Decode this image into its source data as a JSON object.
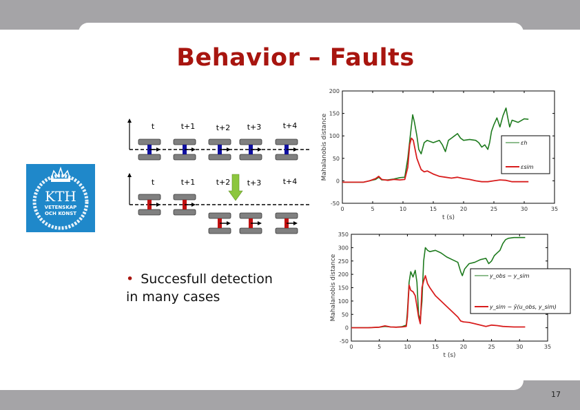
{
  "slide": {
    "title": "Behavior – Faults",
    "page_number": "17",
    "bullet": [
      "Succesfull detection",
      "in many cases"
    ],
    "colors": {
      "title": "#a8150f",
      "band": "#a5a4a7",
      "logo_bg": "#1f88ca"
    }
  },
  "logo": {
    "name": "KTH",
    "line1": "VETENSKAP",
    "line2": "OCH KONST"
  },
  "diagram": {
    "normal_row": {
      "labels": [
        "t",
        "t+1",
        "t+2",
        "t+3",
        "t+4"
      ],
      "color": "#1010a0"
    },
    "fault_row": {
      "labels": [
        "t",
        "t+1",
        "t+2",
        "t+3",
        "t+4"
      ],
      "color": "#c01010",
      "fault_at": "t+2"
    },
    "arrow_color": "#8cc63e"
  },
  "chart_data": [
    {
      "type": "line",
      "title": "",
      "xlabel": "t (s)",
      "ylabel": "Mahalanobis distance",
      "xlim": [
        0,
        35
      ],
      "ylim": [
        -50,
        200
      ],
      "xticks": [
        0,
        5,
        10,
        15,
        20,
        25,
        30,
        35
      ],
      "yticks": [
        -50,
        0,
        50,
        100,
        150,
        200
      ],
      "legend": "right",
      "series": [
        {
          "name": "εh",
          "color": "#1d7a1d",
          "x": [
            0,
            2,
            3.5,
            4.5,
            5.5,
            6,
            6.5,
            7.5,
            8.5,
            9.5,
            10.3,
            10.8,
            11.2,
            11.6,
            11.9,
            12.3,
            12.6,
            13,
            13.5,
            14,
            15,
            16,
            16.5,
            17,
            17.5,
            18,
            18.5,
            19,
            19.5,
            20,
            21,
            22,
            22.5,
            23,
            23.5,
            24,
            24.3,
            24.6,
            25,
            25.5,
            26,
            26.5,
            27,
            27.3,
            27.6,
            28,
            29,
            30,
            30.7
          ],
          "values": [
            -3,
            -3,
            -3,
            0,
            3,
            8,
            2,
            2,
            4,
            7,
            8,
            50,
            100,
            147,
            130,
            100,
            70,
            60,
            85,
            90,
            85,
            90,
            80,
            65,
            90,
            95,
            100,
            105,
            95,
            90,
            92,
            90,
            85,
            75,
            80,
            70,
            85,
            110,
            125,
            140,
            120,
            145,
            162,
            140,
            120,
            135,
            130,
            138,
            137
          ]
        },
        {
          "name": "εsim",
          "color": "#d81c1c",
          "x": [
            0,
            2,
            3.5,
            4.5,
            5.5,
            6,
            6.5,
            7.5,
            8.5,
            9.5,
            10.3,
            10.8,
            11.1,
            11.4,
            11.7,
            12,
            12.3,
            12.7,
            13,
            13.5,
            14,
            15,
            16,
            17,
            18,
            19,
            20,
            21,
            22,
            23,
            24,
            25,
            26,
            27,
            28,
            29,
            30,
            30.7
          ],
          "values": [
            -3,
            -3,
            -3,
            0,
            5,
            10,
            3,
            1,
            3,
            2,
            3,
            30,
            80,
            95,
            90,
            70,
            50,
            35,
            25,
            20,
            22,
            15,
            10,
            8,
            6,
            8,
            5,
            3,
            0,
            -2,
            -2,
            0,
            2,
            1,
            -2,
            -2,
            -2,
            -2
          ]
        }
      ]
    },
    {
      "type": "line",
      "title": "",
      "xlabel": "t (s)",
      "ylabel": "Mahalanobis distance",
      "xlim": [
        0,
        35
      ],
      "ylim": [
        -50,
        350
      ],
      "xticks": [
        0,
        5,
        10,
        15,
        20,
        25,
        30,
        35
      ],
      "yticks": [
        -50,
        0,
        50,
        100,
        150,
        200,
        250,
        300,
        350
      ],
      "legend": "right",
      "series": [
        {
          "name": "y_obs − y_sim",
          "color": "#1d7a1d",
          "x": [
            0,
            3,
            5,
            6,
            7,
            8,
            9,
            9.8,
            10,
            10.3,
            10.6,
            11,
            11.4,
            11.7,
            12,
            12.3,
            12.6,
            12.9,
            13.2,
            13.6,
            14,
            15,
            16,
            17,
            18,
            19,
            19.5,
            19.8,
            20.2,
            21,
            22,
            23,
            24,
            24.5,
            25,
            25.5,
            26,
            26.5,
            27,
            27.5,
            28,
            29,
            30,
            31
          ],
          "values": [
            0,
            0,
            2,
            5,
            3,
            2,
            4,
            10,
            60,
            170,
            210,
            190,
            215,
            170,
            50,
            30,
            100,
            250,
            300,
            290,
            285,
            290,
            280,
            265,
            255,
            245,
            210,
            195,
            220,
            240,
            245,
            255,
            260,
            240,
            250,
            270,
            280,
            290,
            315,
            330,
            335,
            338,
            338,
            338
          ]
        },
        {
          "name": "y_sim − ŷ(u_obs, y_sim)",
          "color": "#d81c1c",
          "x": [
            0,
            3,
            5,
            6,
            7,
            8,
            9,
            9.8,
            10,
            10.3,
            10.6,
            11,
            11.4,
            11.7,
            12,
            12.3,
            12.6,
            12.9,
            13.2,
            13.6,
            14,
            15,
            16,
            17,
            18,
            19,
            19.5,
            20,
            21,
            22,
            23,
            24,
            25,
            26,
            27,
            28,
            29,
            30,
            31
          ],
          "values": [
            0,
            0,
            2,
            7,
            3,
            2,
            3,
            5,
            40,
            160,
            140,
            135,
            120,
            80,
            40,
            15,
            150,
            175,
            195,
            165,
            150,
            120,
            100,
            80,
            60,
            40,
            25,
            22,
            20,
            15,
            10,
            5,
            10,
            8,
            5,
            4,
            3,
            3,
            3
          ]
        }
      ]
    }
  ]
}
